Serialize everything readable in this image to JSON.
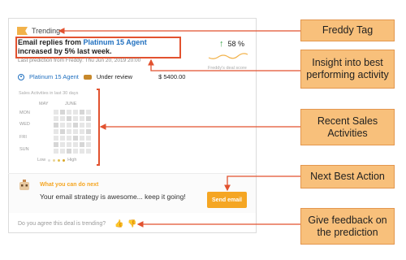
{
  "card": {
    "tag": "Trending",
    "insight": {
      "prefix": "Email replies from",
      "agent": "Platinum 15 Agent",
      "suffix": "increased by 5% last week."
    },
    "last_prediction": "Last prediction from Freddy: Thu Jun 20, 2019 20:00",
    "score": "58 %",
    "score_label": "Freddy's deal score",
    "agent_name": "Platinum 15 Agent",
    "status": "Under review",
    "amount": "$ 5400.00",
    "heatmap": {
      "title": "Sales Activities in last 30 days",
      "months": [
        "MAY",
        "JUNE"
      ],
      "days": [
        "MON",
        "WED",
        "FRI",
        "SUN"
      ],
      "legend_low": "Low",
      "legend_high": "High"
    },
    "next_action": {
      "title": "What you can do next",
      "text": "Your email strategy is awesome... keep it going!",
      "button": "Send email"
    },
    "feedback_prompt": "Do you agree this deal is trending?"
  },
  "callouts": [
    "Freddy Tag",
    "Insight into best performing activity",
    "Recent Sales Activities",
    "Next Best Action",
    "Give feedback on the prediction"
  ],
  "colors": {
    "accent": "#f5a623",
    "callout_fill": "#f8c07b",
    "arrow": "#e2522f",
    "link": "#1f6fbf",
    "positive": "#3aa34a"
  },
  "icons": [
    "flag-icon",
    "arrow-up-icon",
    "agent-icon",
    "review-icon",
    "bot-icon",
    "thumbs-up-icon",
    "thumbs-down-icon"
  ]
}
